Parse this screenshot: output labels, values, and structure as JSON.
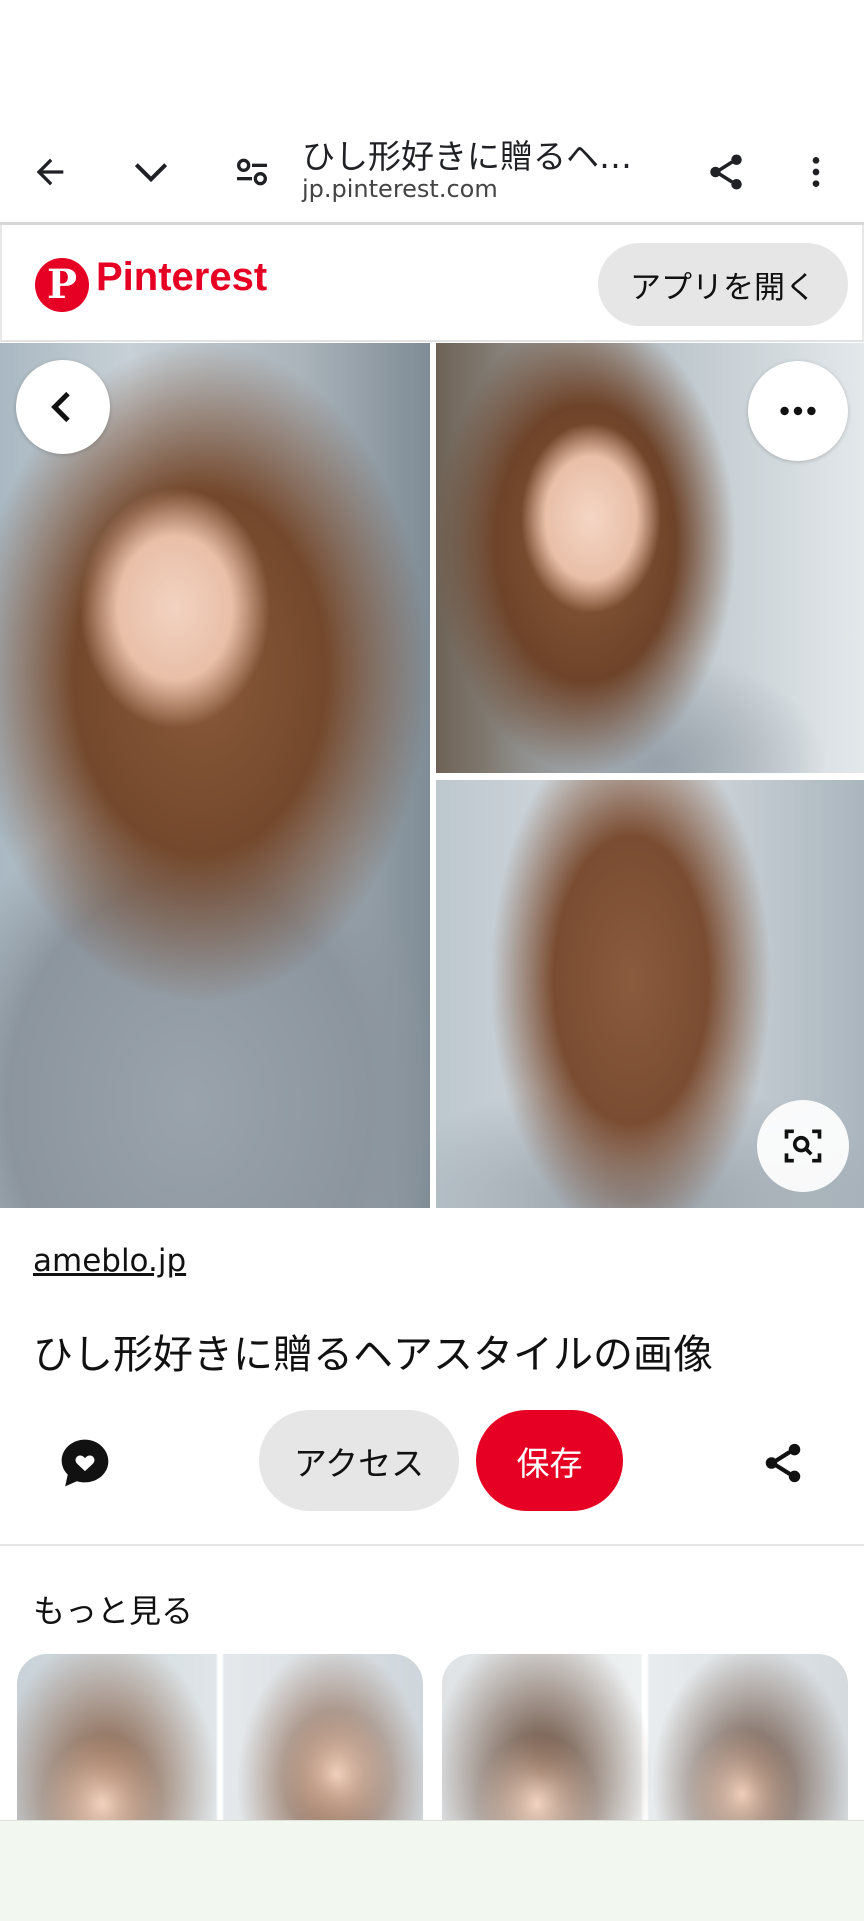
{
  "browser": {
    "page_title": "ひし形好きに贈るヘア…",
    "url": "jp.pinterest.com",
    "icons": [
      "back-arrow-icon",
      "chevron-down-icon",
      "site-settings-icon",
      "share-icon",
      "more-vert-icon"
    ]
  },
  "header": {
    "brand": "Pinterest",
    "logo_letter": "P",
    "open_app_label": "アプリを開く"
  },
  "pin": {
    "source": "ameblo.jp",
    "title": "ひし形好きに贈るヘアスタイルの画像",
    "access_label": "アクセス",
    "save_label": "保存"
  },
  "more": {
    "title": "もっと見る"
  },
  "colors": {
    "pinterest_red": "#e60023",
    "chip_grey": "#e6e6e6",
    "bottom_bar": "#f2f7ef"
  }
}
